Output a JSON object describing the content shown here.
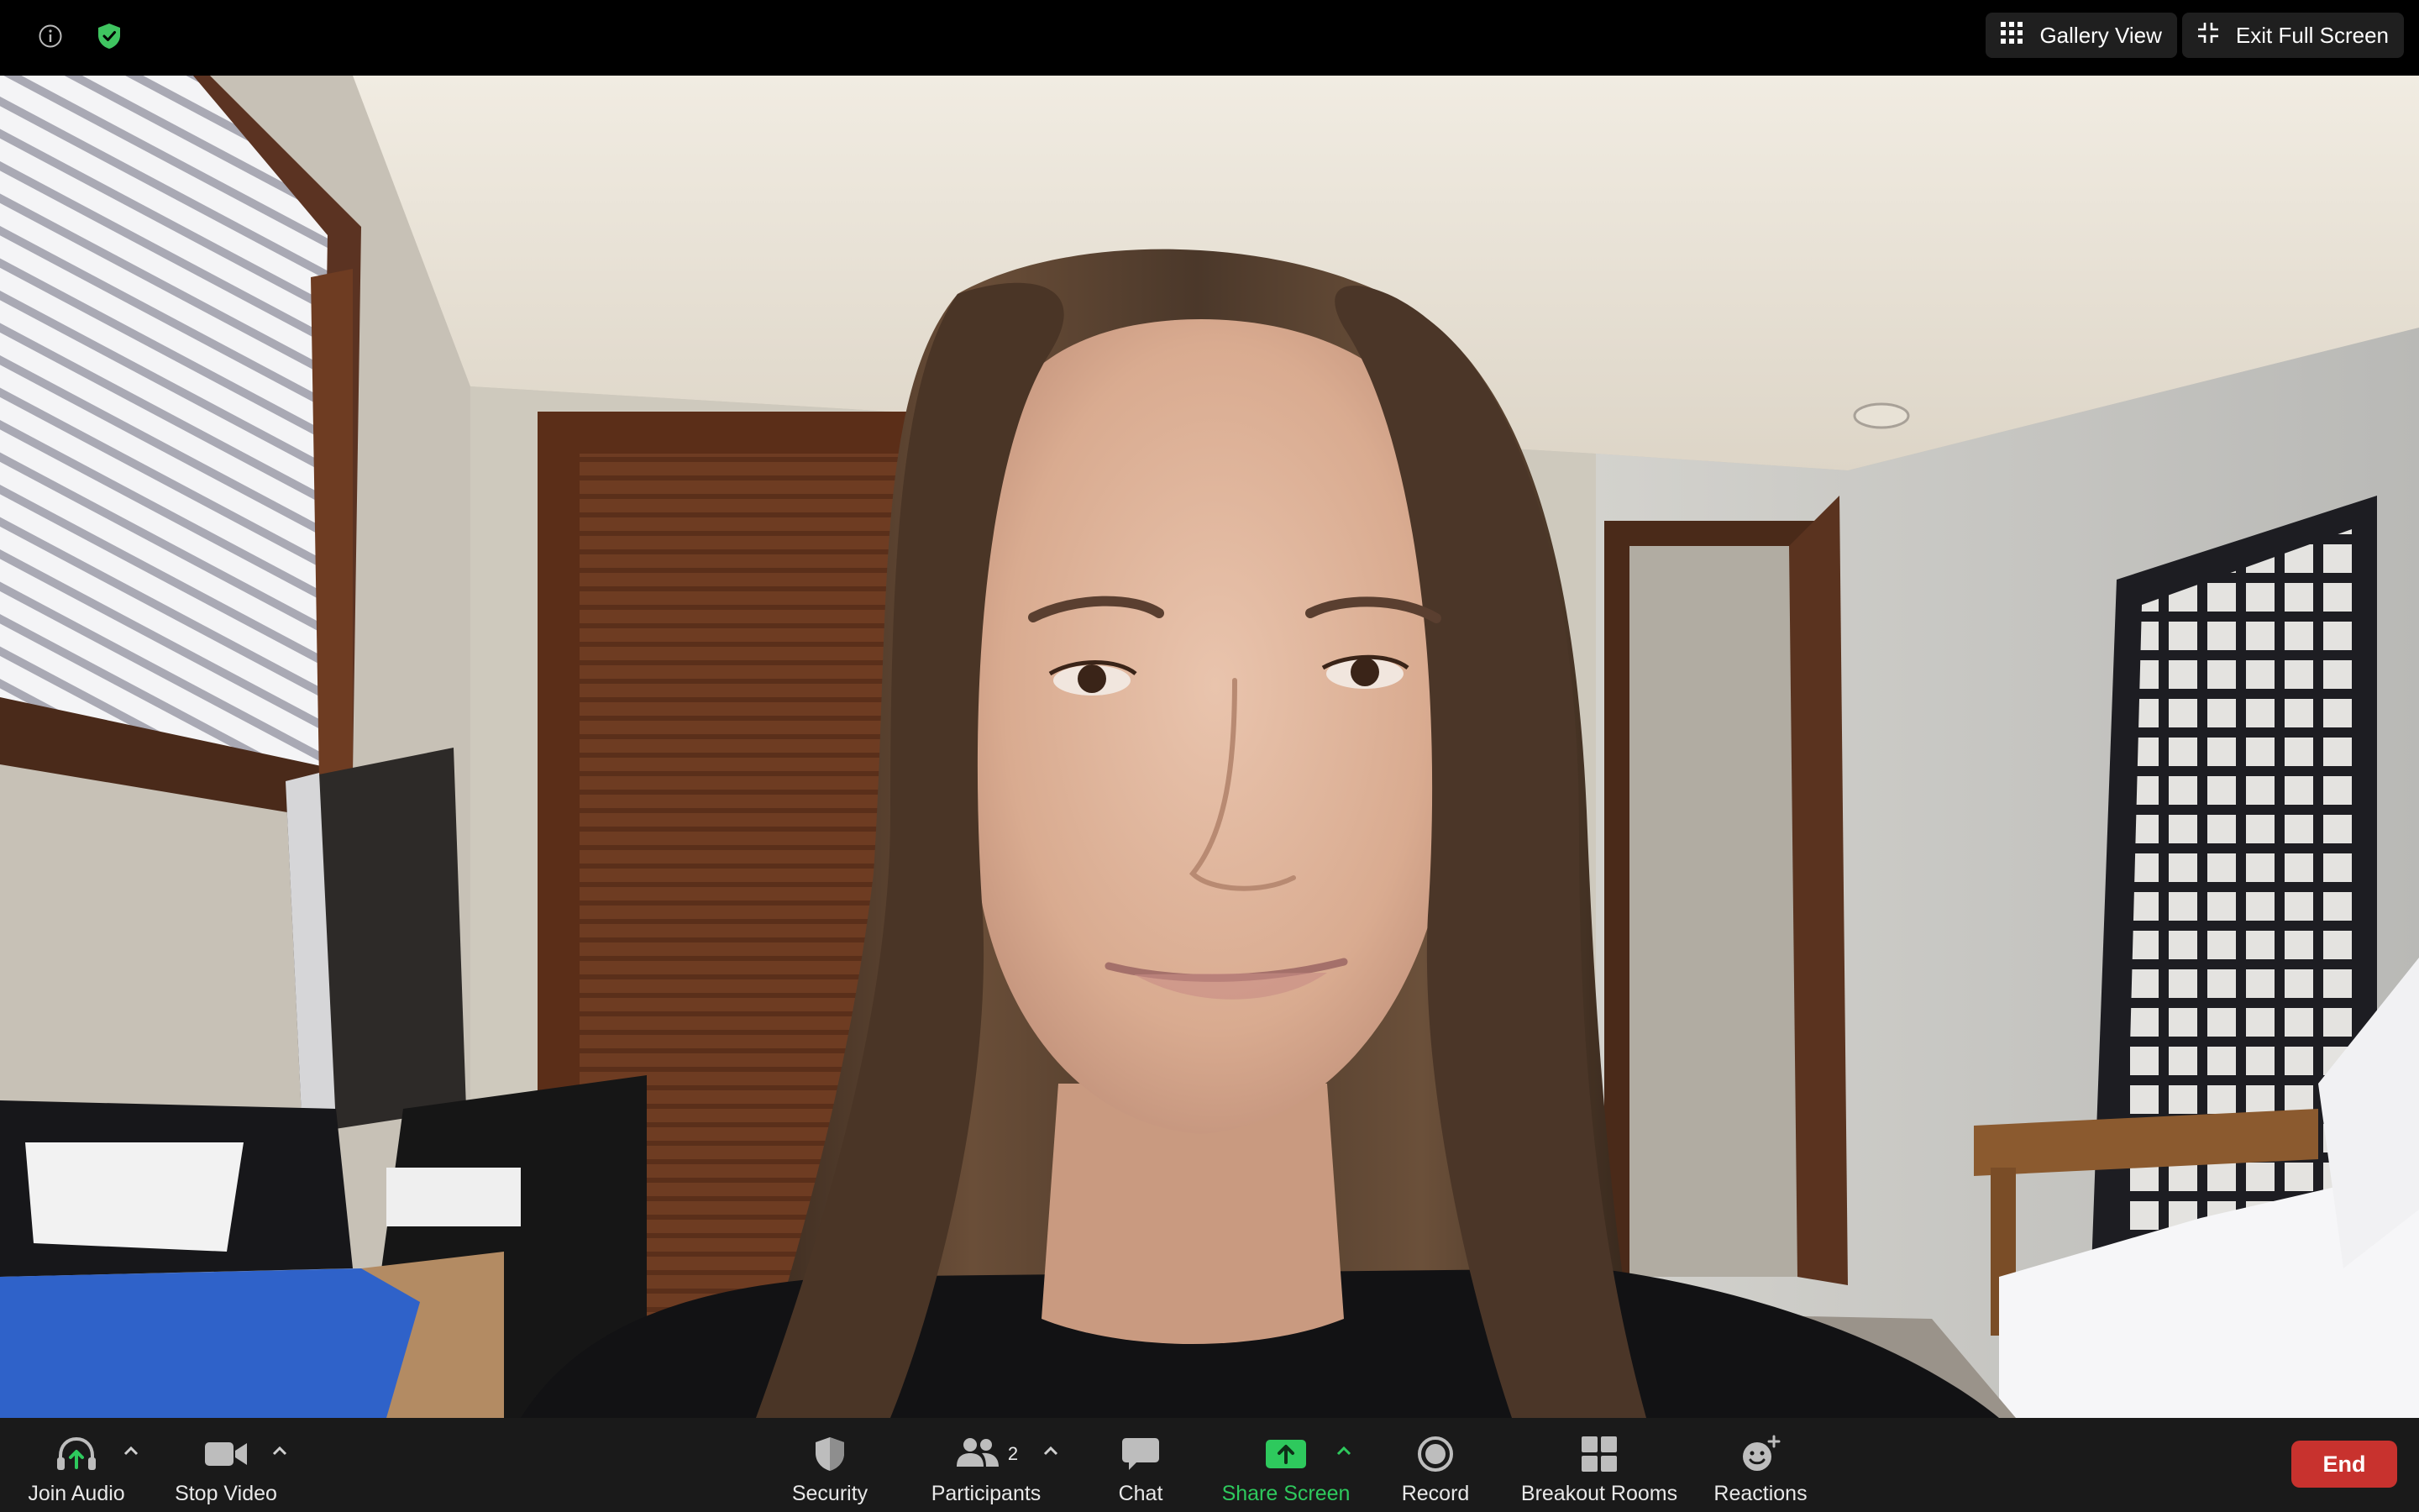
{
  "topbar": {
    "info_icon": "info-icon",
    "shield_icon": "shield-check-icon",
    "shield_color": "#3fc460",
    "gallery_view_label": "Gallery View",
    "exit_fullscreen_label": "Exit Full Screen"
  },
  "video": {
    "description_icon": "participant-video-feed"
  },
  "toolbar": {
    "join_audio_label": "Join Audio",
    "stop_video_label": "Stop Video",
    "security_label": "Security",
    "participants_label": "Participants",
    "participants_count": "2",
    "chat_label": "Chat",
    "share_screen_label": "Share Screen",
    "record_label": "Record",
    "breakout_rooms_label": "Breakout Rooms",
    "reactions_label": "Reactions",
    "end_label": "End",
    "share_color": "#2ec95d",
    "end_color": "#c8322e"
  }
}
